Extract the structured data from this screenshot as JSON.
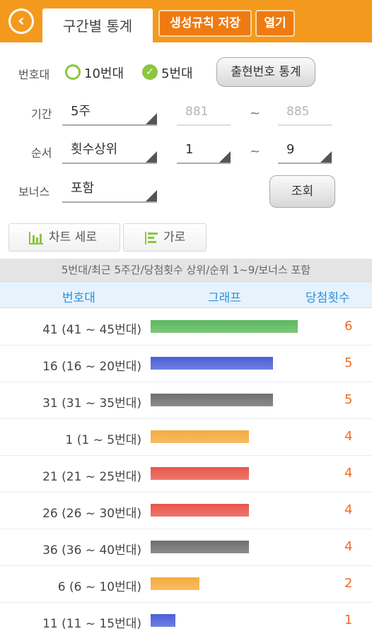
{
  "header": {
    "back_icon": "back-arrow-icon",
    "active_tab": "구간별 통계",
    "save_label": "생성규칙 저장",
    "open_label": "열기",
    "accent": "#f39a1e"
  },
  "form": {
    "band_label": "번호대",
    "band_option_10": "10번대",
    "band_option_5": "5번대",
    "band_selected": "5번대",
    "stats_button": "출현번호 통계",
    "period_label": "기간",
    "period_value": "5주",
    "period_from": "881",
    "period_tilde": "~",
    "period_to": "885",
    "order_label": "순서",
    "order_value": "횟수상위",
    "order_from": "1",
    "order_tilde": "~",
    "order_to": "9",
    "bonus_label": "보너스",
    "bonus_value": "포함",
    "search_button": "조회"
  },
  "view": {
    "vertical_label": "차트 세로",
    "horizontal_label": "가로",
    "vertical_icon": "bar-chart-icon",
    "horizontal_icon": "horizontal-bar-icon"
  },
  "summary": "5번대/최근 5주간/당첨횟수 상위/순위 1~9/보너스 포함",
  "columns": {
    "band": "번호대",
    "graph": "그래프",
    "count": "당첨횟수"
  },
  "rows": [
    {
      "label": "41 (41 ~ 45번대)",
      "count": "6",
      "value": 6,
      "color": "#5cb85c"
    },
    {
      "label": "16 (16 ~ 20번대)",
      "count": "5",
      "value": 5,
      "color": "#4a5fd8"
    },
    {
      "label": "31 (31 ~ 35번대)",
      "count": "5",
      "value": 5,
      "color": "#6f6f6f"
    },
    {
      "label": "1 (1 ~ 5번대)",
      "count": "4",
      "value": 4,
      "color": "#f5ab3e"
    },
    {
      "label": "21 (21 ~ 25번대)",
      "count": "4",
      "value": 4,
      "color": "#e8554a"
    },
    {
      "label": "26 (26 ~ 30번대)",
      "count": "4",
      "value": 4,
      "color": "#e8554a"
    },
    {
      "label": "36 (36 ~ 40번대)",
      "count": "4",
      "value": 4,
      "color": "#6f6f6f"
    },
    {
      "label": "6 (6 ~ 10번대)",
      "count": "2",
      "value": 2,
      "color": "#f5ab3e"
    },
    {
      "label": "11 (11 ~ 15번대)",
      "count": "1",
      "value": 1,
      "color": "#4a5fd8"
    }
  ]
}
